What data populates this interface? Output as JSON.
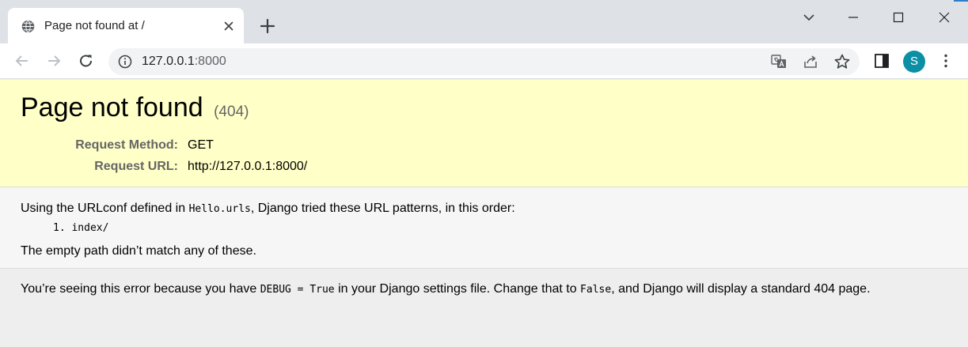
{
  "browser": {
    "tab": {
      "title": "Page not found at /",
      "favicon": "globe-icon",
      "close_icon": "close-icon"
    },
    "new_tab_icon": "plus-icon",
    "window_controls": [
      "chevron-down-icon",
      "minimize-icon",
      "maximize-icon",
      "close-icon"
    ],
    "address_bar": {
      "host": "127.0.0.1",
      "port": ":8000",
      "info_icon": "info-icon"
    },
    "toolbar_icons": [
      "back-icon",
      "forward-icon",
      "reload-icon",
      "translate-icon",
      "share-icon",
      "star-icon",
      "side-panel-icon",
      "more-vert-icon"
    ],
    "profile_initial": "S",
    "profile_color": "#0b8fa5"
  },
  "page": {
    "title": "Page not found",
    "status_code": "(404)",
    "request": [
      {
        "key": "Request Method:",
        "value": "GET"
      },
      {
        "key": "Request URL:",
        "value": "http://127.0.0.1:8000/"
      }
    ],
    "urlconf": {
      "prefix": "Using the URLconf defined in ",
      "module": "Hello.urls",
      "suffix": ", Django tried these URL patterns, in this order:"
    },
    "patterns": [
      "1. index/"
    ],
    "no_match": "The empty path didn’t match any of these.",
    "debug_note": {
      "part1": "You’re seeing this error because you have ",
      "code1": "DEBUG = True",
      "part2": " in your Django settings file. Change that to ",
      "code2": "False",
      "part3": ", and Django will display a standard 404 page."
    },
    "colors": {
      "summary_bg": "#ffffc8",
      "info_bg": "#f6f6f6",
      "explanation_bg": "#eeeeee"
    }
  }
}
